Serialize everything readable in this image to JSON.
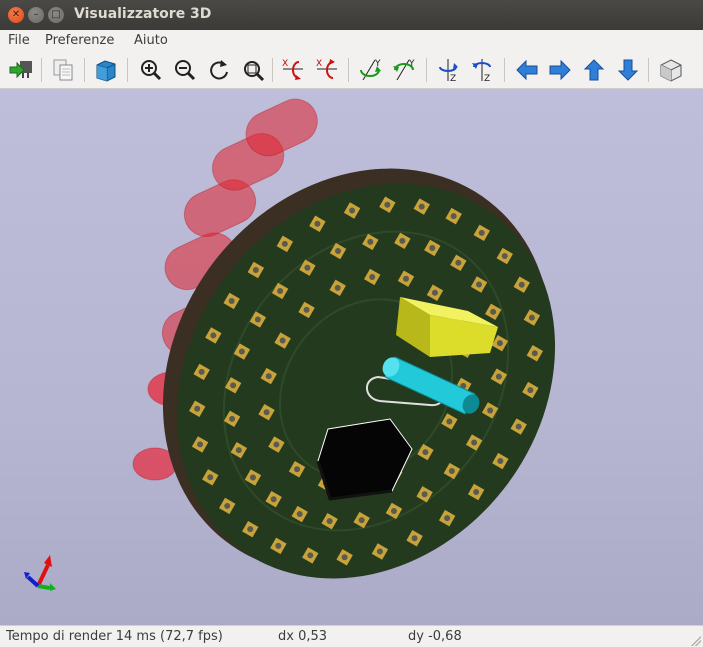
{
  "window": {
    "title": "Visualizzatore 3D",
    "close_glyph": "✕",
    "minimize_glyph": "–",
    "maximize_glyph": "□"
  },
  "menu": [
    {
      "label": "File"
    },
    {
      "label": "Preferenze"
    },
    {
      "label": "Aiuto"
    }
  ],
  "toolbar": {
    "icons": [
      "reload-board-icon",
      "copy-to-clipboard-icon",
      "render-options-cube-icon",
      "zoom-in-icon",
      "zoom-out-icon",
      "redraw-icon",
      "zoom-fit-icon",
      "rotate-x-cw-icon",
      "rotate-x-ccw-icon",
      "rotate-y-cw-icon",
      "rotate-y-ccw-icon",
      "rotate-z-cw-icon",
      "rotate-z-ccw-icon",
      "pan-left-icon",
      "pan-right-icon",
      "pan-up-icon",
      "pan-down-icon",
      "ortho-cube-icon"
    ],
    "axis_labels": {
      "x": "X",
      "y": "Y",
      "z": "Z"
    }
  },
  "colors": {
    "viewport_bg": "#b7b7d3",
    "board": "#243a1f",
    "board_edge": "#3b2e22",
    "pad": "#c8a33a",
    "led": "#e0222e",
    "component_yellow": "#dcdc2a",
    "component_cyan": "#22c9d8",
    "chip": "#050505",
    "axis_x": "#e01010",
    "axis_y": "#10b020",
    "axis_z": "#1020d0"
  },
  "status": {
    "render_time": "Tempo di render 14 ms (72,7 fps)",
    "dx": "dx 0,53",
    "dy": "dy -0,68"
  }
}
